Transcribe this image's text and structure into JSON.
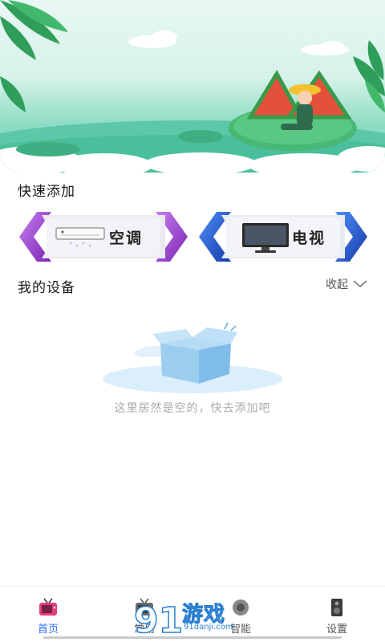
{
  "quick_add": {
    "title": "快速添加",
    "items": [
      {
        "label": "空调",
        "icon": "air-conditioner-icon",
        "accent": "#9b45c7"
      },
      {
        "label": "电视",
        "icon": "tv-icon",
        "accent": "#1f55d6"
      }
    ]
  },
  "devices": {
    "title": "我的设备",
    "collapse_label": "收起",
    "empty_text": "这里居然是空的，快去添加吧"
  },
  "tabs": [
    {
      "label": "首页",
      "icon": "tv-home-icon",
      "active": true
    },
    {
      "label": "常用",
      "icon": "remote-icon",
      "active": false
    },
    {
      "label": "智能",
      "icon": "smart-icon",
      "active": false
    },
    {
      "label": "设置",
      "icon": "speaker-icon",
      "active": false
    }
  ],
  "watermark": {
    "text": "游戏",
    "url": "91danji.com"
  },
  "colors": {
    "active_tab": "#2d6ff0",
    "banner": "#8ddcc4"
  }
}
